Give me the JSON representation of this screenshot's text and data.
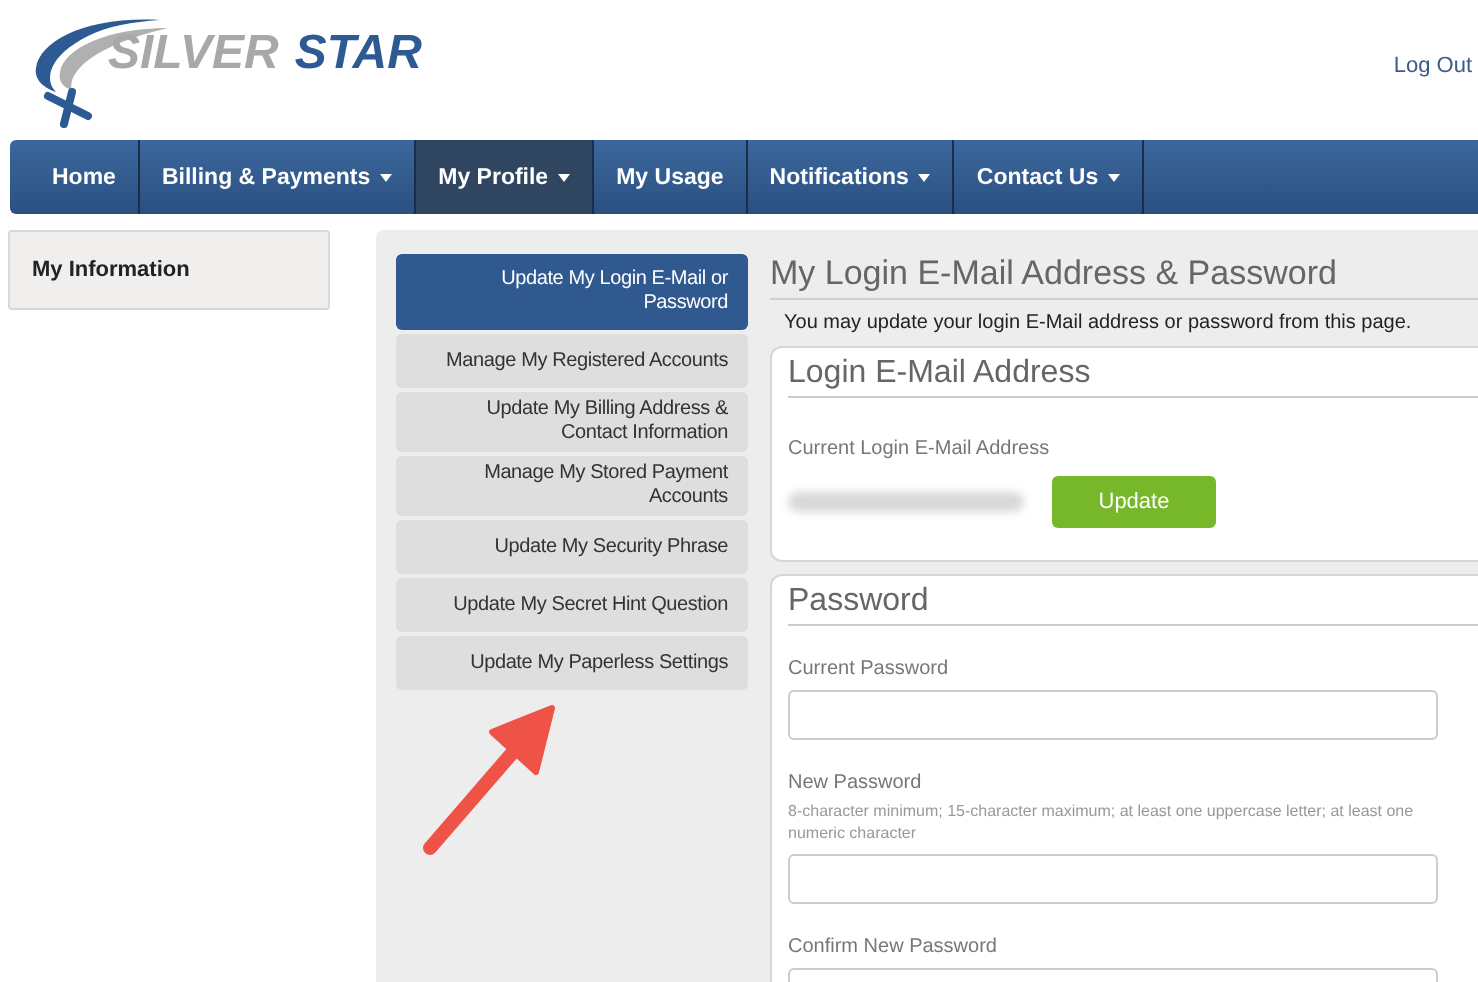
{
  "header": {
    "logo": {
      "word_1": "SILVER",
      "word_2": "STAR"
    },
    "logout": "Log Out"
  },
  "nav": [
    {
      "label": "Home",
      "dropdown": false,
      "selected": false
    },
    {
      "label": "Billing & Payments",
      "dropdown": true,
      "selected": false
    },
    {
      "label": "My Profile",
      "dropdown": true,
      "selected": true
    },
    {
      "label": "My Usage",
      "dropdown": false,
      "selected": false
    },
    {
      "label": "Notifications",
      "dropdown": true,
      "selected": false
    },
    {
      "label": "Contact Us",
      "dropdown": true,
      "selected": false
    }
  ],
  "left_panel": {
    "title": "My Information"
  },
  "submenu": [
    {
      "label": "Update My Login E-Mail or Password",
      "selected": true
    },
    {
      "label": "Manage My Registered Accounts",
      "selected": false
    },
    {
      "label": "Update My Billing Address & Contact Information",
      "selected": false
    },
    {
      "label": "Manage My Stored Payment Accounts",
      "selected": false
    },
    {
      "label": "Update My Security Phrase",
      "selected": false
    },
    {
      "label": "Update My Secret Hint Question",
      "selected": false
    },
    {
      "label": "Update My Paperless Settings",
      "selected": false
    }
  ],
  "content": {
    "title": "My Login E-Mail Address & Password",
    "intro": "You may update your login E-Mail address or password from this page.",
    "email_card": {
      "title": "Login E-Mail Address",
      "label": "Current Login E-Mail Address",
      "button": "Update"
    },
    "password_card": {
      "title": "Password",
      "fields": [
        {
          "label": "Current Password"
        },
        {
          "label": "New Password",
          "hint": "8-character minimum; 15-character maximum; at least one uppercase letter; at least one numeric character"
        },
        {
          "label": "Confirm New Password"
        }
      ]
    }
  }
}
